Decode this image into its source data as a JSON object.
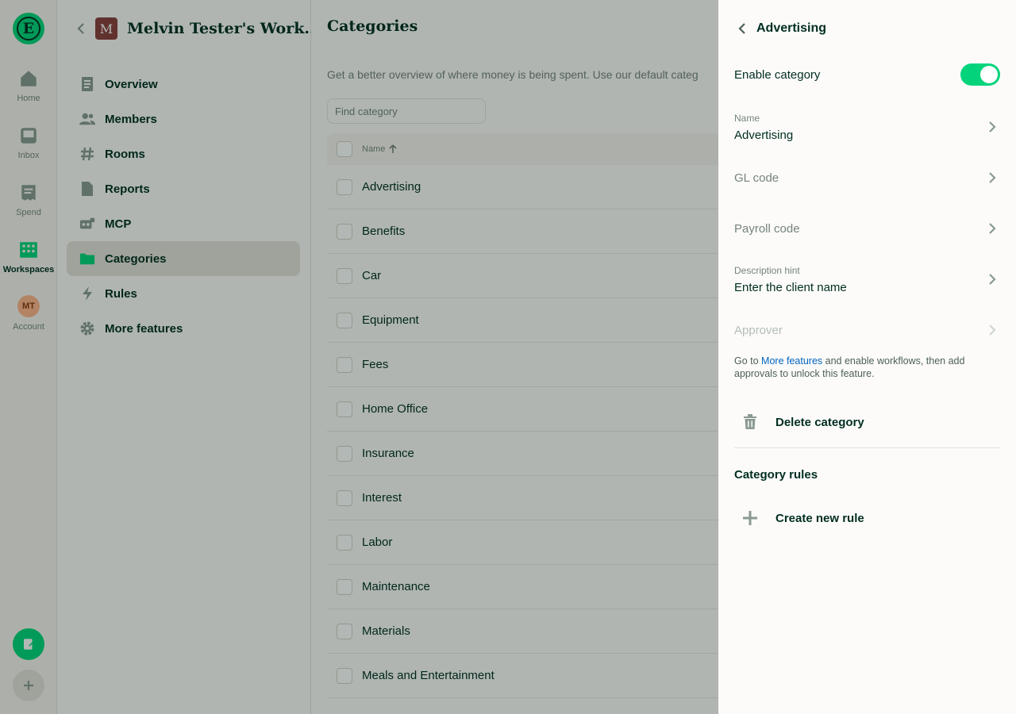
{
  "rail": {
    "items": [
      {
        "label": "Home",
        "icon": "home-icon"
      },
      {
        "label": "Inbox",
        "icon": "inbox-icon"
      },
      {
        "label": "Spend",
        "icon": "receipt-icon"
      },
      {
        "label": "Workspaces",
        "icon": "building-icon"
      },
      {
        "label": "Account",
        "icon": "avatar"
      }
    ],
    "account_initials": "MT",
    "logo_letter": "E"
  },
  "workspace": {
    "avatar_letter": "M",
    "name": "Melvin Tester's Work..."
  },
  "sidenav": {
    "items": [
      {
        "label": "Overview",
        "icon": "document-icon"
      },
      {
        "label": "Members",
        "icon": "users-icon"
      },
      {
        "label": "Rooms",
        "icon": "hashtag-icon"
      },
      {
        "label": "Reports",
        "icon": "file-icon"
      },
      {
        "label": "MCP",
        "icon": "cards-icon"
      },
      {
        "label": "Categories",
        "icon": "folder-icon",
        "active": true
      },
      {
        "label": "Rules",
        "icon": "bolt-icon"
      },
      {
        "label": "More features",
        "icon": "gear-icon"
      }
    ]
  },
  "main": {
    "title": "Categories",
    "description": "Get a better overview of where money is being spent. Use our default categ",
    "search_placeholder": "Find category",
    "column_name": "Name",
    "rows": [
      "Advertising",
      "Benefits",
      "Car",
      "Equipment",
      "Fees",
      "Home Office",
      "Insurance",
      "Interest",
      "Labor",
      "Maintenance",
      "Materials",
      "Meals and Entertainment"
    ]
  },
  "panel": {
    "title": "Advertising",
    "enable_label": "Enable category",
    "enabled": true,
    "name_label": "Name",
    "name_value": "Advertising",
    "gl_code_label": "GL code",
    "payroll_code_label": "Payroll code",
    "description_hint_label": "Description hint",
    "description_hint_value": "Enter the client name",
    "approver_label": "Approver",
    "hint_prefix": "Go to ",
    "hint_link": "More features",
    "hint_suffix": " and enable workflows, then add approvals to unlock this feature.",
    "delete_label": "Delete category",
    "rules_title": "Category rules",
    "create_rule_label": "Create new rule"
  },
  "colors": {
    "accent_green": "#03d47c",
    "text_dark": "#002e22",
    "link_blue": "#0164bf"
  }
}
